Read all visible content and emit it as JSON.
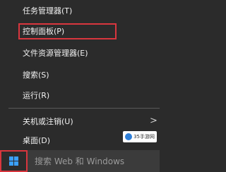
{
  "context_menu": {
    "items": [
      {
        "label": "任务管理器(T)"
      },
      {
        "label": "控制面板(P)"
      },
      {
        "label": "文件资源管理器(E)"
      },
      {
        "label": "搜索(S)"
      },
      {
        "label": "运行(R)"
      },
      {
        "label": "关机或注销(U)"
      },
      {
        "label": "桌面(D)"
      }
    ],
    "submenu_arrow": ">"
  },
  "watermark": {
    "text": "35手游网"
  },
  "taskbar": {
    "search_placeholder": "搜索 Web 和 Windows"
  },
  "colors": {
    "menu_bg": "#2b2b2b",
    "highlight": "#d9363e",
    "win_logo": "#3aa0ff"
  }
}
